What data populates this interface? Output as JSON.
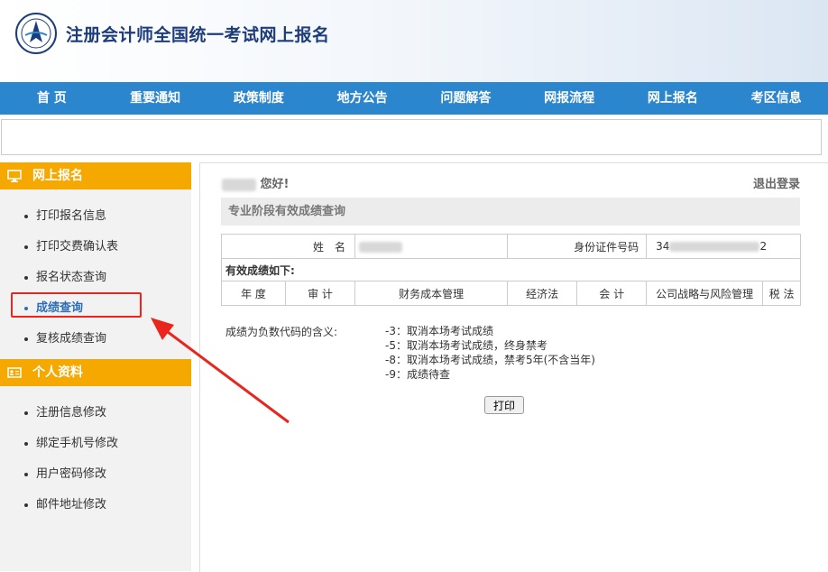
{
  "header": {
    "title": "注册会计师全国统一考试网上报名",
    "logo_icon": "cicpa-emblem-icon"
  },
  "nav": [
    "首 页",
    "重要通知",
    "政策制度",
    "地方公告",
    "问题解答",
    "网报流程",
    "网上报名",
    "考区信息"
  ],
  "sidebar": {
    "section1": {
      "title": "网上报名",
      "icon": "monitor-icon",
      "items": [
        "打印报名信息",
        "打印交费确认表",
        "报名状态查询",
        "成绩查询",
        "复核成绩查询"
      ]
    },
    "section2": {
      "title": "个人资料",
      "icon": "id-card-icon",
      "items": [
        "注册信息修改",
        "绑定手机号修改",
        "用户密码修改",
        "邮件地址修改"
      ]
    }
  },
  "main": {
    "greeting": "您好!",
    "logout": "退出登录",
    "section_title": "专业阶段有效成绩查询",
    "name_label": "姓　名",
    "id_label": "身份证件号码",
    "id_value_start": "34",
    "id_value_end": "2",
    "valid_scores_label": "有效成绩如下:",
    "columns": [
      "年 度",
      "审 计",
      "财务成本管理",
      "经济法",
      "会 计",
      "公司战略与风险管理",
      "税 法"
    ],
    "explain_label": "成绩为负数代码的含义:",
    "codes": [
      "-3：取消本场考试成绩",
      "-5：取消本场考试成绩，终身禁考",
      "-8：取消本场考试成绩，禁考5年(不含当年)",
      "-9：成绩待查"
    ],
    "print_button": "打印"
  },
  "colors": {
    "nav_blue": "#2c86cd",
    "accent_orange": "#f5a800",
    "highlight_red": "#e8261d"
  }
}
